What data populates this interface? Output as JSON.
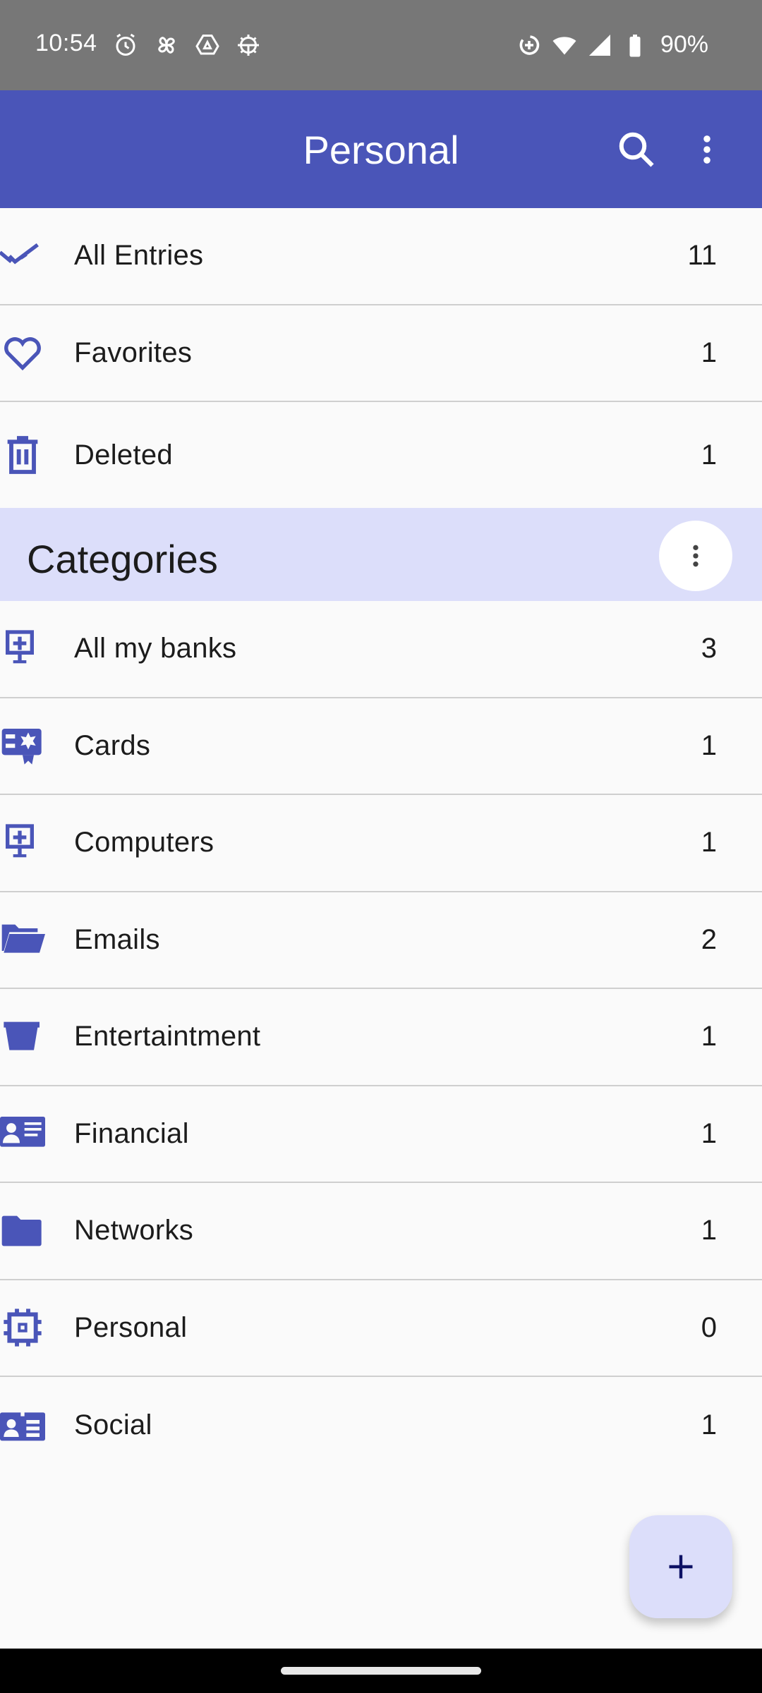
{
  "status_bar": {
    "time": "10:54",
    "left_icons": [
      "alarm-icon",
      "pinwheel-icon",
      "drive-icon",
      "android-debug-icon"
    ],
    "right_icons": [
      "data-saver-icon",
      "wifi-icon",
      "cell-signal-icon",
      "battery-icon"
    ],
    "battery": "90%"
  },
  "app_bar": {
    "title": "Personal",
    "actions": [
      "search-icon",
      "more-vert-icon"
    ]
  },
  "colors": {
    "primary": "#4a55b8",
    "accent_light": "#dcdefa",
    "background": "#fafafa",
    "text": "#1c1c1c",
    "fab_icon": "#0d1165"
  },
  "filters": [
    {
      "label": "All Entries",
      "count": "11",
      "icon": "double-check-icon"
    },
    {
      "label": "Favorites",
      "count": "1",
      "icon": "heart-outline-icon"
    },
    {
      "label": "Deleted",
      "count": "1",
      "icon": "trash-icon"
    }
  ],
  "categories": {
    "title": "Categories",
    "menu_icon": "more-vert-icon",
    "items": [
      {
        "label": "All my banks",
        "count": "3",
        "icon": "monitor-plus-icon"
      },
      {
        "label": "Cards",
        "count": "1",
        "icon": "card-badge-icon"
      },
      {
        "label": "Computers",
        "count": "1",
        "icon": "monitor-plus-icon"
      },
      {
        "label": "Emails",
        "count": "2",
        "icon": "folder-open-icon"
      },
      {
        "label": "Entertaintment",
        "count": "1",
        "icon": "bucket-icon"
      },
      {
        "label": "Financial",
        "count": "1",
        "icon": "contact-card-icon"
      },
      {
        "label": "Networks",
        "count": "1",
        "icon": "folder-icon"
      },
      {
        "label": "Personal",
        "count": "0",
        "icon": "chip-icon"
      },
      {
        "label": "Social",
        "count": "1",
        "icon": "id-badge-icon"
      }
    ]
  },
  "fab": {
    "icon": "plus-icon",
    "label": "+"
  }
}
